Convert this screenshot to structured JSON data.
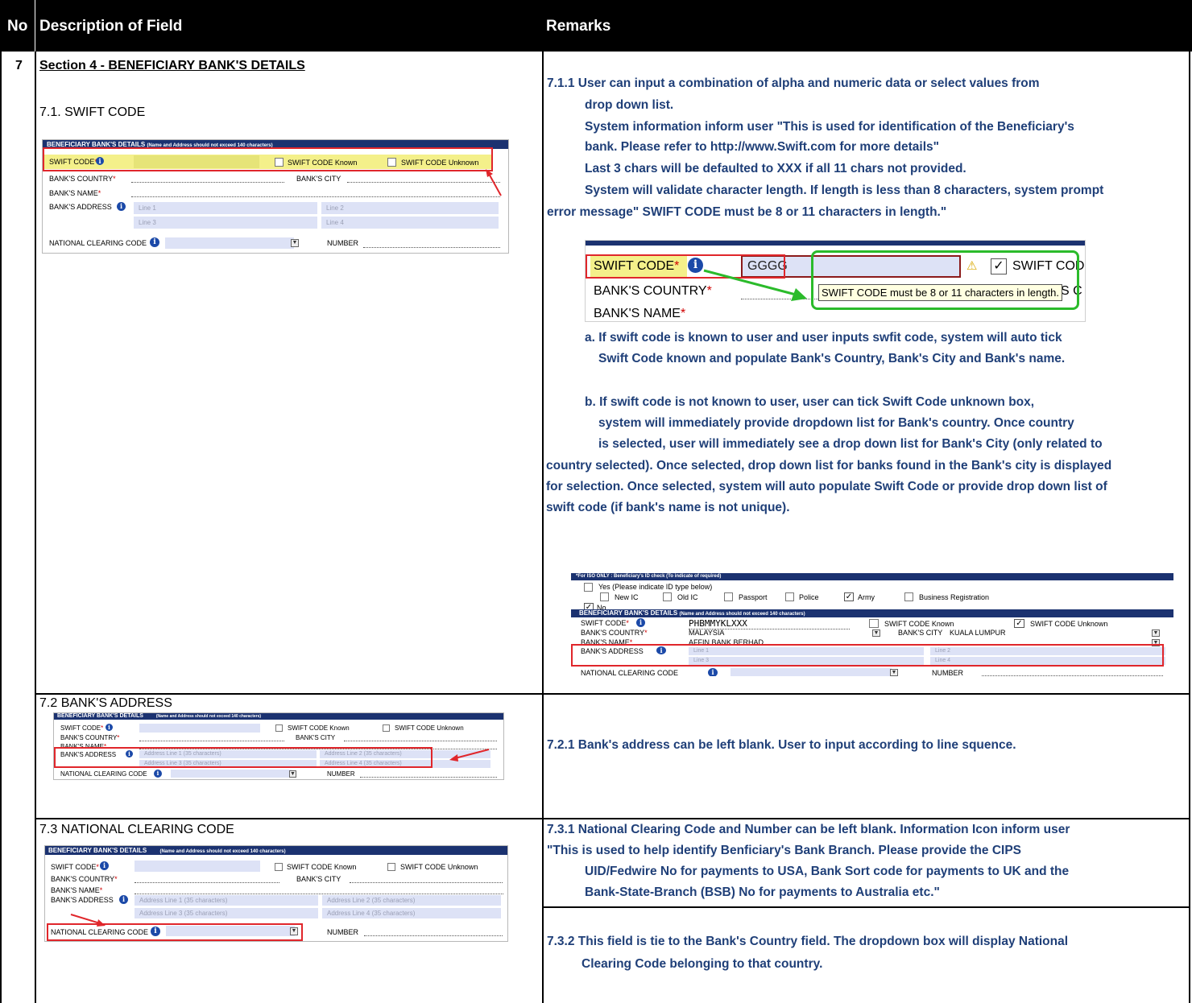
{
  "header": {
    "no": "No",
    "description": "Description of Field",
    "remarks": "Remarks"
  },
  "row": {
    "number": "7",
    "section_title": "Section 4 - BENEFICIARY BANK'S DETAILS",
    "sub_71": "7.1.  SWIFT CODE",
    "sub_72": "7.2 BANK'S ADDRESS",
    "sub_73": "7.3 NATIONAL  CLEARING CODE"
  },
  "form": {
    "bar_title": "BENEFICIARY BANK'S DETAILS",
    "bar_note": "(Name and Address should not exceed 140 characters)",
    "swift_label": "SWIFT CODE",
    "req": "*",
    "swift_known": "SWIFT CODE Known",
    "swift_unknown": "SWIFT CODE Unknown",
    "country_label": "BANK'S COUNTRY",
    "city_label": "BANK'S CITY",
    "name_label": "BANK'S NAME",
    "address_label": "BANK'S ADDRESS",
    "ncc_label": "NATIONAL CLEARING CODE",
    "number_label": "NUMBER",
    "line1": "Line 1",
    "line2": "Line 2",
    "line3": "Line 3",
    "line4": "Line 4",
    "addr1": "Address Line 1 (35 characters)",
    "addr2": "Address Line 2 (35 characters)",
    "addr3": "Address Line 3 (35 characters)",
    "addr4": "Address Line 4 (35 characters)"
  },
  "remarks_711": [
    "7.1.1   User can input a combination of alpha and numeric data or select values from",
    "drop down list.",
    "System information inform user \"This is used for identification of the Beneficiary's",
    "bank. Please refer to http://www.Swift.com for more details\"",
    "Last 3 chars will be defaulted to XXX if all 11 chars not provided.",
    "System will validate character length. If length is less than 8 characters, system prompt",
    "error message\" SWIFT CODE must be 8 or 11 characters in length.\""
  ],
  "validation_shot": {
    "swift_label": "SWIFT CODE",
    "value": "GGGG",
    "warning": "⚠",
    "check": "✓",
    "swift_short": "SWIFT COD",
    "country": "BANK'S COUNTRY",
    "name": "BANK'S NAME",
    "tooltip": "SWIFT CODE must be 8 or 11 characters in length.",
    "clip": "'S C"
  },
  "remarks_a": [
    "a. If swift code is known to user and user inputs swfit code, system will auto tick",
    "Swift Code known and populate Bank's Country, Bank's City and Bank's name."
  ],
  "remarks_b": [
    "b.  If swift code is not known to user, user can tick Swift Code unknown box,",
    "system will immediately provide dropdown list for Bank's country. Once country",
    "is selected, user will immediately see a drop down list for Bank's City (only related to",
    "country selected). Once selected, drop down list for banks found in the Bank's city is displayed",
    "for selection. Once selected, system will auto populate Swift Code or provide drop down list of",
    "swift code (if bank's name is not unique)."
  ],
  "iso_shot": {
    "top_bar": "*For ISO ONLY : Beneficiary's ID check (To indicate of required)",
    "yes": "Yes (Please indicate ID type below)",
    "new_ic": "New IC",
    "old_ic": "Old IC",
    "passport": "Passport",
    "police": "Police",
    "army": "Army",
    "business": "Business Registration",
    "no": "No",
    "bar_title": "BENEFICIARY BANK'S DETAILS",
    "bar_note": "(Name and Address should not exceed 140 characters)",
    "swift_value": "PHBMMYKLXXX",
    "country_value": "MALAYSIA",
    "city_value": "KUALA LUMPUR",
    "bank_value": "AFFIN BANK BERHAD"
  },
  "remarks_721": "7.2.1   Bank's address can be left blank. User to input according to line squence.",
  "remarks_731": [
    "7.3.1   National Clearing Code and Number can be left blank. Information Icon inform  user",
    "\"This is used to help identify Benficiary's Bank Branch. Please provide the CIPS",
    "UID/Fedwire No for payments to USA, Bank Sort code for payments to UK and the",
    "Bank-State-Branch (BSB) No for payments to Australia etc.\""
  ],
  "remarks_732": [
    "7.3.2  This field is tie to the Bank's Country field. The dropdown box will display National",
    "Clearing Code belonging to that country."
  ],
  "colors": {
    "navy_bar": "#1b3270",
    "remark_text": "#1f3f78",
    "highlight_red": "#e0262b",
    "callout_green": "#2bbb2b",
    "swift_yellow": "#f4f08a"
  }
}
